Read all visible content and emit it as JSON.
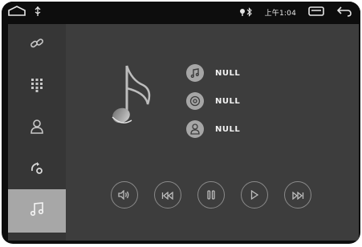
{
  "statusbar": {
    "time": "上午1:04"
  },
  "sidebar": {
    "items": [
      {
        "icon": "link-icon"
      },
      {
        "icon": "dialpad-icon"
      },
      {
        "icon": "contact-icon"
      },
      {
        "icon": "phone-settings-icon"
      },
      {
        "icon": "music-icon",
        "active": true
      }
    ]
  },
  "track_info": {
    "title": "NULL",
    "album": "NULL",
    "artist": "NULL"
  },
  "controls": [
    "volume-icon",
    "previous-icon",
    "pause-icon",
    "play-icon",
    "next-icon"
  ]
}
